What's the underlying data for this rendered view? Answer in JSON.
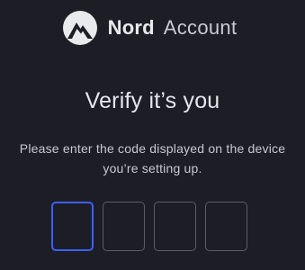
{
  "brand": {
    "name_bold": "Nord",
    "name_light": "Account",
    "logo_icon": "nord-mountain-logo",
    "logo_color": "#e9eaee"
  },
  "heading": {
    "title": "Verify it’s you",
    "subtitle": "Please enter the code displayed on the device you’re setting up."
  },
  "code_input": {
    "digits": [
      {
        "value": "",
        "focused": true
      },
      {
        "value": "",
        "focused": false
      },
      {
        "value": "",
        "focused": false
      },
      {
        "value": "",
        "focused": false
      }
    ],
    "focus_color": "#3e5fff",
    "border_color": "#5b5e69"
  },
  "colors": {
    "background": "#1d1e25",
    "text": "#e6e7ec"
  }
}
